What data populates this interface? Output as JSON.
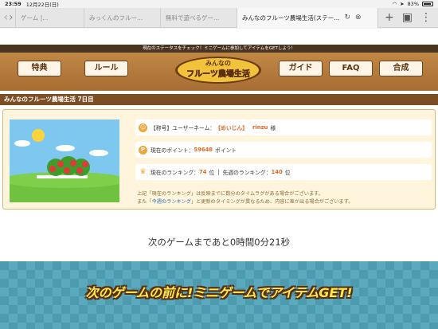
{
  "status": {
    "time": "23:59",
    "date": "12月22日(日)",
    "battery": "83%"
  },
  "tabs": [
    {
      "label": "ゲーム |..."
    },
    {
      "label": "みっくんのフルー..."
    },
    {
      "label": "無料で遊べるゲー..."
    },
    {
      "label": "みんなのフルーツ農場生活(ステー..."
    }
  ],
  "header": {
    "message": "現在のステータスをチェック！ミニゲームに参加してアイテムをGETしよう！",
    "logo_top": "みんなの",
    "logo_bottom": "フルーツ農場生活",
    "nav": [
      "特典",
      "ルール",
      "ガイド",
      "FAQ",
      "合成"
    ]
  },
  "title": "みんなのフルーツ農場生活 7日目",
  "info": {
    "title_label": "【称号】ユーザーネーム：",
    "title_value": "【めいじん】",
    "username": "rinzu",
    "honorific": "様",
    "points_label": "現在のポイント：",
    "points_value": "59648",
    "points_unit": "ポイント",
    "rank_label": "現在のランキング：",
    "rank_value": "74",
    "rank_unit": "位",
    "sep": "|",
    "prev_rank_label": "先週のランキング：",
    "prev_rank_value": "140",
    "prev_rank_unit": "位"
  },
  "notes": {
    "line1": "上記「現在のランキング」は反映までに数分のタイムラグがある場合がございます。",
    "line2_pre": "また「",
    "line2_link": "今週のランキング",
    "line2_post": "」と更新のタイミングが異なるため、内容に差が出る場合がございます。"
  },
  "countdown": "次のゲームまであと0時間0分21秒",
  "banner": "次のゲームの前に!ミニゲームでアイテムGET!",
  "colors": {
    "header_brown": "#b07a3e",
    "title_bar": "#7d4d23",
    "accent_orange": "#e46a22",
    "link_blue": "#2b6fb3",
    "banner_teal": "#4e9bb0"
  }
}
